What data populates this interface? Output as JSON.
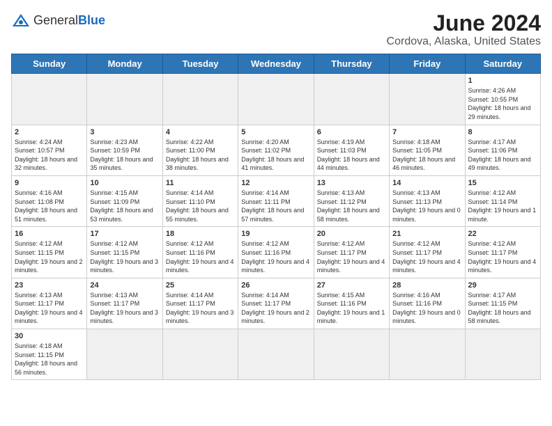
{
  "header": {
    "logo_general": "General",
    "logo_blue": "Blue",
    "month_title": "June 2024",
    "location": "Cordova, Alaska, United States"
  },
  "days_of_week": [
    "Sunday",
    "Monday",
    "Tuesday",
    "Wednesday",
    "Thursday",
    "Friday",
    "Saturday"
  ],
  "weeks": [
    [
      {
        "day": "",
        "info": ""
      },
      {
        "day": "",
        "info": ""
      },
      {
        "day": "",
        "info": ""
      },
      {
        "day": "",
        "info": ""
      },
      {
        "day": "",
        "info": ""
      },
      {
        "day": "",
        "info": ""
      },
      {
        "day": "1",
        "info": "Sunrise: 4:26 AM\nSunset: 10:55 PM\nDaylight: 18 hours and 29 minutes."
      }
    ],
    [
      {
        "day": "2",
        "info": "Sunrise: 4:24 AM\nSunset: 10:57 PM\nDaylight: 18 hours and 32 minutes."
      },
      {
        "day": "3",
        "info": "Sunrise: 4:23 AM\nSunset: 10:59 PM\nDaylight: 18 hours and 35 minutes."
      },
      {
        "day": "4",
        "info": "Sunrise: 4:22 AM\nSunset: 11:00 PM\nDaylight: 18 hours and 38 minutes."
      },
      {
        "day": "5",
        "info": "Sunrise: 4:20 AM\nSunset: 11:02 PM\nDaylight: 18 hours and 41 minutes."
      },
      {
        "day": "6",
        "info": "Sunrise: 4:19 AM\nSunset: 11:03 PM\nDaylight: 18 hours and 44 minutes."
      },
      {
        "day": "7",
        "info": "Sunrise: 4:18 AM\nSunset: 11:05 PM\nDaylight: 18 hours and 46 minutes."
      },
      {
        "day": "8",
        "info": "Sunrise: 4:17 AM\nSunset: 11:06 PM\nDaylight: 18 hours and 49 minutes."
      }
    ],
    [
      {
        "day": "9",
        "info": "Sunrise: 4:16 AM\nSunset: 11:08 PM\nDaylight: 18 hours and 51 minutes."
      },
      {
        "day": "10",
        "info": "Sunrise: 4:15 AM\nSunset: 11:09 PM\nDaylight: 18 hours and 53 minutes."
      },
      {
        "day": "11",
        "info": "Sunrise: 4:14 AM\nSunset: 11:10 PM\nDaylight: 18 hours and 55 minutes."
      },
      {
        "day": "12",
        "info": "Sunrise: 4:14 AM\nSunset: 11:11 PM\nDaylight: 18 hours and 57 minutes."
      },
      {
        "day": "13",
        "info": "Sunrise: 4:13 AM\nSunset: 11:12 PM\nDaylight: 18 hours and 58 minutes."
      },
      {
        "day": "14",
        "info": "Sunrise: 4:13 AM\nSunset: 11:13 PM\nDaylight: 19 hours and 0 minutes."
      },
      {
        "day": "15",
        "info": "Sunrise: 4:12 AM\nSunset: 11:14 PM\nDaylight: 19 hours and 1 minute."
      }
    ],
    [
      {
        "day": "16",
        "info": "Sunrise: 4:12 AM\nSunset: 11:15 PM\nDaylight: 19 hours and 2 minutes."
      },
      {
        "day": "17",
        "info": "Sunrise: 4:12 AM\nSunset: 11:15 PM\nDaylight: 19 hours and 3 minutes."
      },
      {
        "day": "18",
        "info": "Sunrise: 4:12 AM\nSunset: 11:16 PM\nDaylight: 19 hours and 4 minutes."
      },
      {
        "day": "19",
        "info": "Sunrise: 4:12 AM\nSunset: 11:16 PM\nDaylight: 19 hours and 4 minutes."
      },
      {
        "day": "20",
        "info": "Sunrise: 4:12 AM\nSunset: 11:17 PM\nDaylight: 19 hours and 4 minutes."
      },
      {
        "day": "21",
        "info": "Sunrise: 4:12 AM\nSunset: 11:17 PM\nDaylight: 19 hours and 4 minutes."
      },
      {
        "day": "22",
        "info": "Sunrise: 4:12 AM\nSunset: 11:17 PM\nDaylight: 19 hours and 4 minutes."
      }
    ],
    [
      {
        "day": "23",
        "info": "Sunrise: 4:13 AM\nSunset: 11:17 PM\nDaylight: 19 hours and 4 minutes."
      },
      {
        "day": "24",
        "info": "Sunrise: 4:13 AM\nSunset: 11:17 PM\nDaylight: 19 hours and 3 minutes."
      },
      {
        "day": "25",
        "info": "Sunrise: 4:14 AM\nSunset: 11:17 PM\nDaylight: 19 hours and 3 minutes."
      },
      {
        "day": "26",
        "info": "Sunrise: 4:14 AM\nSunset: 11:17 PM\nDaylight: 19 hours and 2 minutes."
      },
      {
        "day": "27",
        "info": "Sunrise: 4:15 AM\nSunset: 11:16 PM\nDaylight: 19 hours and 1 minute."
      },
      {
        "day": "28",
        "info": "Sunrise: 4:16 AM\nSunset: 11:16 PM\nDaylight: 19 hours and 0 minutes."
      },
      {
        "day": "29",
        "info": "Sunrise: 4:17 AM\nSunset: 11:15 PM\nDaylight: 18 hours and 58 minutes."
      }
    ],
    [
      {
        "day": "30",
        "info": "Sunrise: 4:18 AM\nSunset: 11:15 PM\nDaylight: 18 hours and 56 minutes."
      },
      {
        "day": "",
        "info": ""
      },
      {
        "day": "",
        "info": ""
      },
      {
        "day": "",
        "info": ""
      },
      {
        "day": "",
        "info": ""
      },
      {
        "day": "",
        "info": ""
      },
      {
        "day": "",
        "info": ""
      }
    ]
  ]
}
